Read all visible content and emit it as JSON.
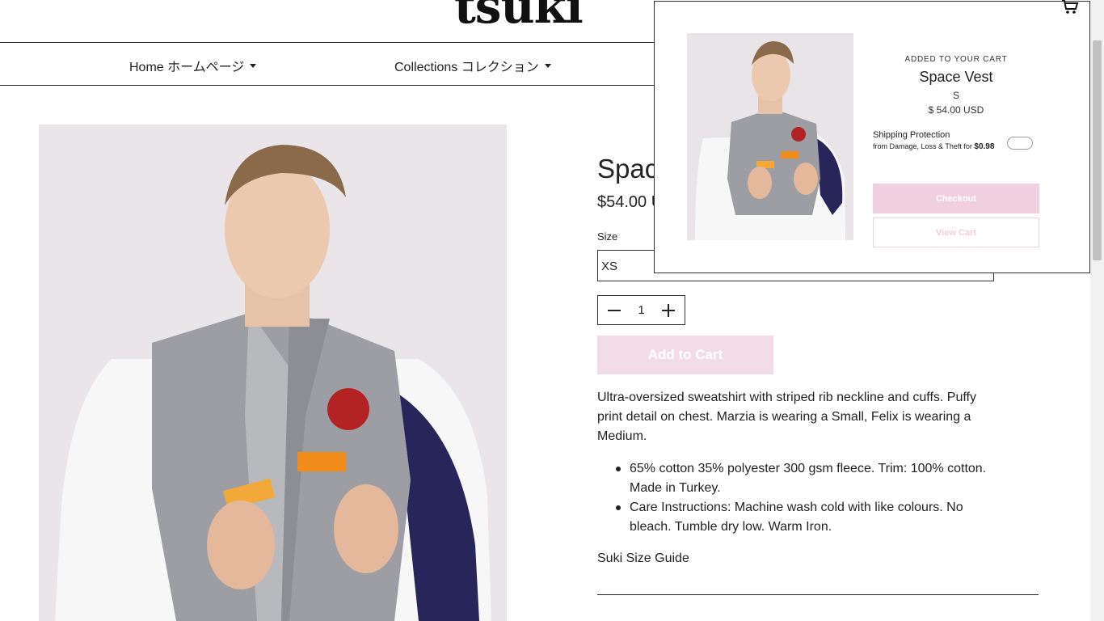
{
  "header": {
    "logo": "tsuki",
    "nav": [
      {
        "label": "Home ホームページ"
      },
      {
        "label": "Collections コレクション"
      }
    ]
  },
  "product": {
    "title": "Space Vest",
    "price": "$54.00 USD",
    "size_label": "Size",
    "size_selected": "XS",
    "quantity": "1",
    "add_to_cart": "Add to Cart",
    "description": "Ultra-oversized sweatshirt with striped rib neckline and cuffs. Puffy print detail on chest. Marzia is wearing a Small, Felix is wearing a Medium.",
    "bullets": [
      "65% cotton 35% polyester 300 gsm fleece. Trim: 100% cotton. Made in Turkey.",
      "Care Instructions: Machine wash cold with like colours. No bleach. Tumble dry low. Warm Iron."
    ],
    "size_guide": "Suki Size Guide"
  },
  "cart_popup": {
    "added_label": "ADDED TO YOUR CART",
    "name": "Space Vest",
    "size": "S",
    "price": "$ 54.00 USD",
    "shipping_title": "Shipping Protection",
    "shipping_sub": "from Damage, Loss & Theft for",
    "shipping_price": "$0.98",
    "checkout": "Checkout",
    "view_cart": "View Cart"
  },
  "icons": {
    "cart": "cart-icon",
    "caret": "chevron-down-icon"
  },
  "colors": {
    "accent_pink": "#f0cfdf",
    "add_to_cart_bg": "#f2dde7",
    "text": "#222222"
  }
}
